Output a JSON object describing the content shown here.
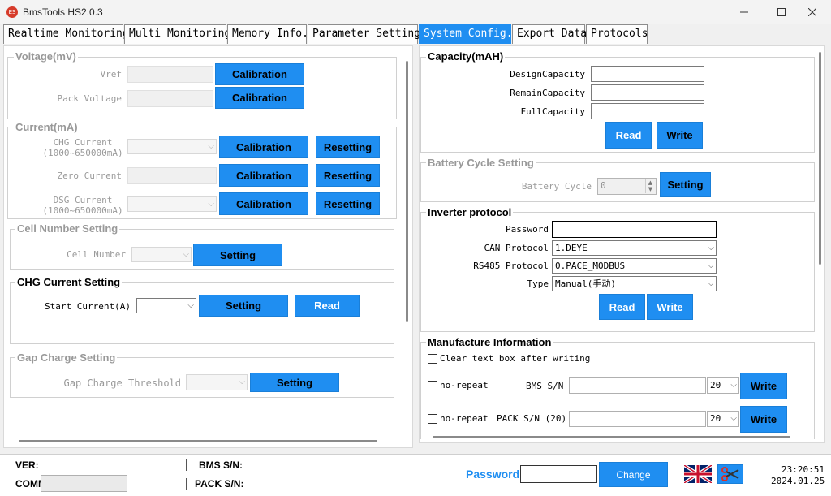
{
  "window": {
    "title": "BmsTools HS2.0.3",
    "icon_text": "ES"
  },
  "tabs": [
    {
      "label": "Realtime Monitoring"
    },
    {
      "label": "Multi Monitoring"
    },
    {
      "label": "Memory Info."
    },
    {
      "label": "Parameter Setting"
    },
    {
      "label": "System Config."
    },
    {
      "label": "Export Data"
    },
    {
      "label": "Protocols"
    }
  ],
  "active_tab": "System Config.",
  "voltage": {
    "title": "Voltage(mV)",
    "vref_label": "Vref",
    "vref_button": "Calibration",
    "pack_voltage_label": "Pack Voltage",
    "pack_voltage_button": "Calibration"
  },
  "current": {
    "title": "Current(mA)",
    "chg_label_1": "CHG Current",
    "chg_label_2": "(1000~650000mA)",
    "chg_calibration": "Calibration",
    "chg_resetting": "Resetting",
    "zero_label": "Zero Current",
    "zero_calibration": "Calibration",
    "zero_resetting": "Resetting",
    "dsg_label_1": "DSG Current",
    "dsg_label_2": "(1000~650000mA)",
    "dsg_calibration": "Calibration",
    "dsg_resetting": "Resetting"
  },
  "cell_number": {
    "title": "Cell Number Setting",
    "label": "Cell Number",
    "button": "Setting"
  },
  "chg_current_setting": {
    "title": "CHG Current Setting",
    "label": "Start Current(A)",
    "setting_button": "Setting",
    "read_button": "Read"
  },
  "gap_charge": {
    "title": "Gap Charge Setting",
    "label": "Gap Charge Threshold",
    "button": "Setting"
  },
  "capacity": {
    "title": "Capacity(mAH)",
    "design_label": "DesignCapacity",
    "remain_label": "RemainCapacity",
    "full_label": "FullCapacity",
    "read_button": "Read",
    "write_button": "Write"
  },
  "battery_cycle": {
    "title": "Battery Cycle Setting",
    "label": "Battery Cycle",
    "value": "0",
    "button": "Setting"
  },
  "inverter": {
    "title": "Inverter protocol",
    "password_label": "Password",
    "password_value": "",
    "can_label": "CAN Protocol",
    "can_value": "1.DEYE",
    "rs485_label": "RS485 Protocol",
    "rs485_value": "0.PACE_MODBUS",
    "type_label": "Type",
    "type_value": "Manual(手动)",
    "read_button": "Read",
    "write_button": "Write"
  },
  "manufacture": {
    "title": "Manufacture Information",
    "clear_label": "Clear text box after writing",
    "bms_norepeat_label": "no-repeat",
    "bms_sn_label": "BMS S/N",
    "bms_sn_count": "20",
    "bms_write_button": "Write",
    "pack_norepeat_label": "no-repeat",
    "pack_sn_label": "PACK S/N (20)",
    "pack_sn_count": "20",
    "pack_write_button": "Write"
  },
  "statusbar": {
    "ver_label": "VER:",
    "comm_label": "COMM:",
    "bms_sn_label": "BMS S/N:",
    "pack_sn_label": "PACK S/N:",
    "password_label": "Password",
    "change_button": "Change",
    "time": "23:20:51",
    "date": "2024.01.25"
  },
  "colors": {
    "accent": "#1f8ef1",
    "password_label": "#1f8ef1"
  },
  "icons": [
    "app-logo-icon",
    "minimize-icon",
    "maximize-icon",
    "close-icon",
    "uk-flag-icon",
    "scissors-icon",
    "chevron-down-icon",
    "spin-up-icon",
    "spin-down-icon"
  ]
}
